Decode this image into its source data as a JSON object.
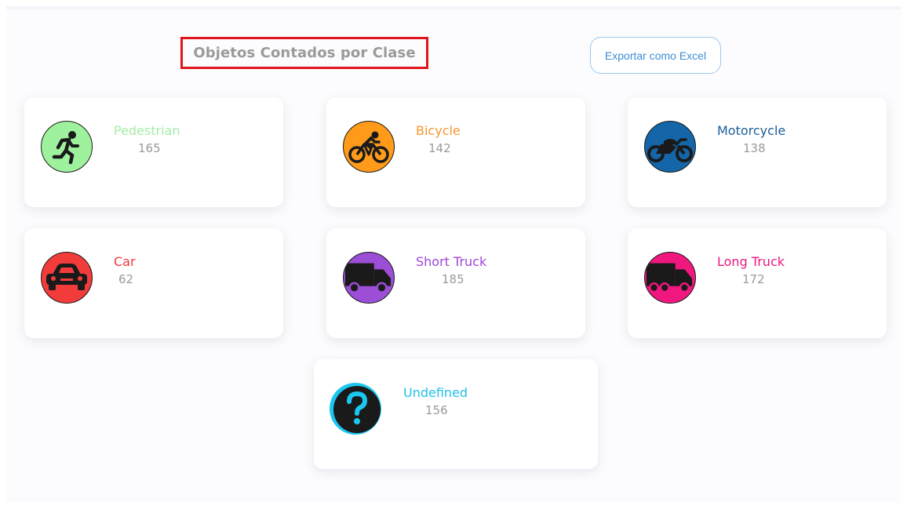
{
  "header": {
    "title": "Objetos Contados por Clase",
    "export_label": "Exportar como Excel"
  },
  "cards": [
    {
      "label": "Pedestrian",
      "count": "165",
      "color": "#9ef29e",
      "text_color": "#a6eda6",
      "icon": "running-person-icon"
    },
    {
      "label": "Bicycle",
      "count": "142",
      "color": "#ff9a1a",
      "text_color": "#f7962e",
      "icon": "bicycle-icon"
    },
    {
      "label": "Motorcycle",
      "count": "138",
      "color": "#1466a8",
      "text_color": "#1a5e99",
      "icon": "motorcycle-icon"
    },
    {
      "label": "Car",
      "count": "62",
      "color": "#f23b3b",
      "text_color": "#f03a3a",
      "icon": "car-icon"
    },
    {
      "label": "Short Truck",
      "count": "185",
      "color": "#9c4ed6",
      "text_color": "#a046d8",
      "icon": "short-truck-icon"
    },
    {
      "label": "Long Truck",
      "count": "172",
      "color": "#f0177e",
      "text_color": "#e8197e",
      "icon": "long-truck-icon"
    },
    {
      "label": "Undefined",
      "count": "156",
      "color": "#1bc7f0",
      "text_color": "#21c0e8",
      "icon": "question-mark-icon"
    }
  ]
}
